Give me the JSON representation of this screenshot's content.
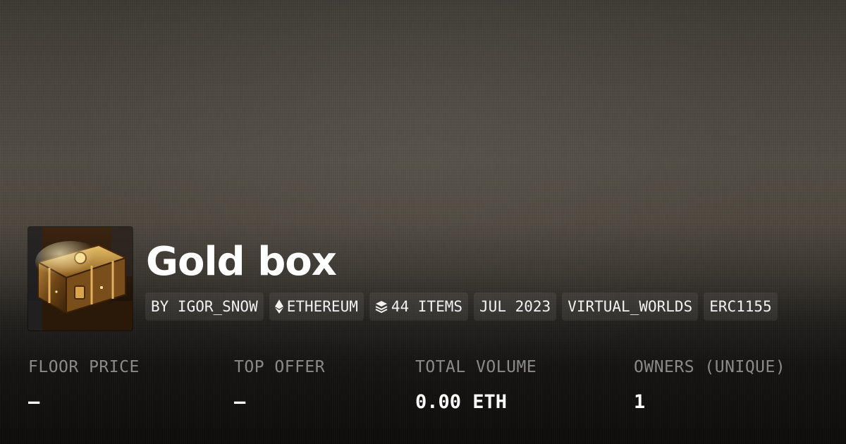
{
  "collection": {
    "title": "Gold box",
    "thumbnail_icon": "treasure-chest-image"
  },
  "chips": [
    {
      "label": "BY IGOR_SNOW",
      "icon": ""
    },
    {
      "label": "ETHEREUM",
      "icon": "ethereum-icon"
    },
    {
      "label": "44 ITEMS",
      "icon": "layers-icon"
    },
    {
      "label": "JUL 2023",
      "icon": ""
    },
    {
      "label": "VIRTUAL_WORLDS",
      "icon": ""
    },
    {
      "label": "ERC1155",
      "icon": ""
    }
  ],
  "stats": [
    {
      "label": "FLOOR PRICE",
      "value": "—"
    },
    {
      "label": "TOP OFFER",
      "value": "—"
    },
    {
      "label": "TOTAL VOLUME",
      "value": "0.00 ETH"
    },
    {
      "label": "OWNERS (UNIQUE)",
      "value": "1"
    }
  ],
  "colors": {
    "text_primary": "#ffffff",
    "text_muted": "#8a8a8a",
    "chip_bg": "rgba(255,255,255,0.07)"
  }
}
